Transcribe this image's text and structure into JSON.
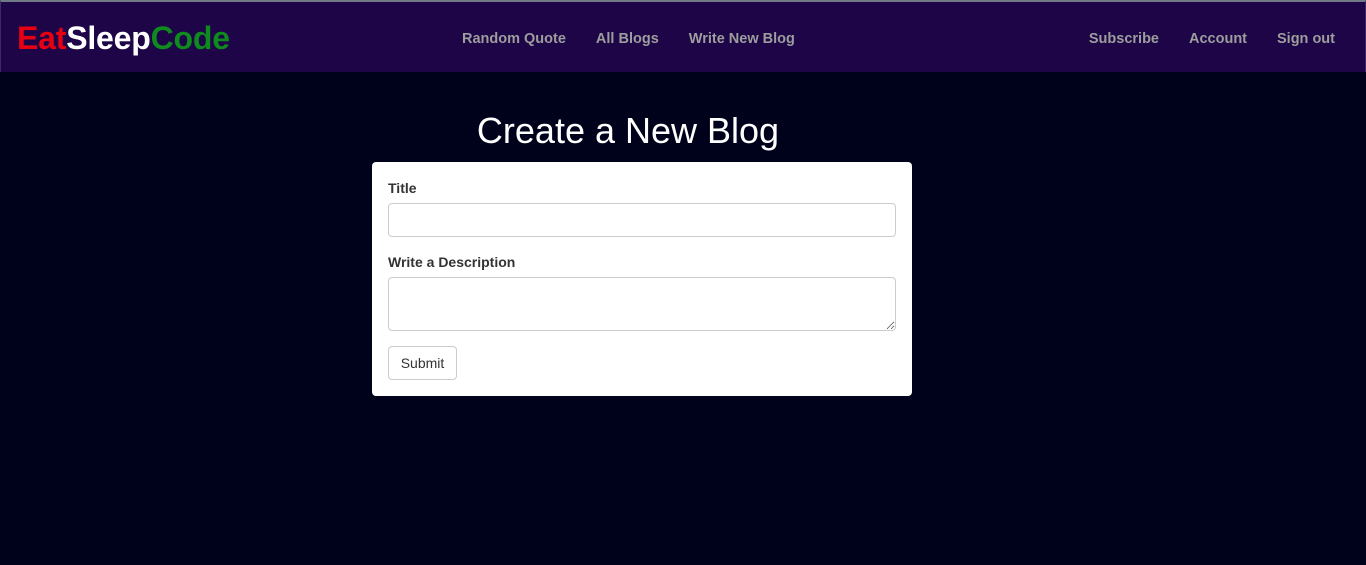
{
  "brand": {
    "part1": "Eat",
    "part2": "Sleep",
    "part3": "Code"
  },
  "nav": {
    "center": [
      "Random Quote",
      "All Blogs",
      "Write New Blog"
    ],
    "right": [
      "Subscribe",
      "Account",
      "Sign out"
    ]
  },
  "page": {
    "title": "Create a New Blog"
  },
  "form": {
    "title_label": "Title",
    "title_value": "",
    "description_label": "Write a Description",
    "description_value": "",
    "submit_label": "Submit"
  }
}
